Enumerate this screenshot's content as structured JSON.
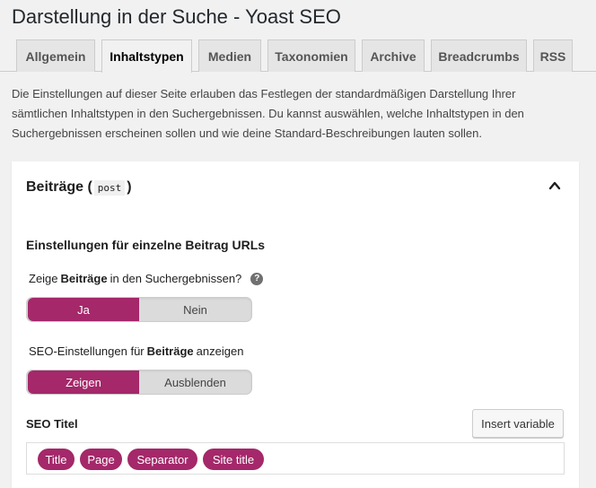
{
  "page": {
    "title": "Darstellung in der Suche - Yoast SEO"
  },
  "tabs": [
    {
      "label": "Allgemein"
    },
    {
      "label": "Inhaltstypen"
    },
    {
      "label": "Medien"
    },
    {
      "label": "Taxonomien"
    },
    {
      "label": "Archive"
    },
    {
      "label": "Breadcrumbs"
    },
    {
      "label": "RSS"
    }
  ],
  "active_tab": "Inhaltstypen",
  "intro": {
    "line1": "Die Einstellungen auf dieser Seite erlauben das Festlegen der standardmäßigen Darstellung Ihrer",
    "line2": "sämtlichen Inhaltstypen in den Suchergebnissen. Du kannst auswählen, welche Inhaltstypen in den",
    "line3": "Suchergebnissen erscheinen sollen und wie deine Standard-Beschreibungen lauten sollen."
  },
  "panel": {
    "title": "Beiträge (",
    "post_type": "post",
    "title_close": ")",
    "section_title": "Einstellungen für einzelne Beitrag URLs",
    "show_in_search": {
      "label_prefix": "Zeige",
      "label_bold": "Beiträge",
      "label_suffix": "in den Suchergebnissen?",
      "help_icon": "?",
      "options": [
        "Ja",
        "Nein"
      ],
      "selected": "Ja"
    },
    "seo_settings": {
      "label_prefix": "SEO-Einstellungen für",
      "label_bold": "Beiträge",
      "label_suffix": "anzeigen",
      "options": [
        "Zeigen",
        "Ausblenden"
      ],
      "selected": "Zeigen"
    },
    "seo_title": {
      "label": "SEO Titel",
      "insert_variable": "Insert variable",
      "variables": [
        "Title",
        "Page",
        "Separator",
        "Site title"
      ]
    }
  },
  "colors": {
    "accent": "#a4286a",
    "background": "#f1f1f1"
  },
  "icons": {
    "collapse": "chevron-up-icon",
    "help": "question-circle-icon"
  }
}
